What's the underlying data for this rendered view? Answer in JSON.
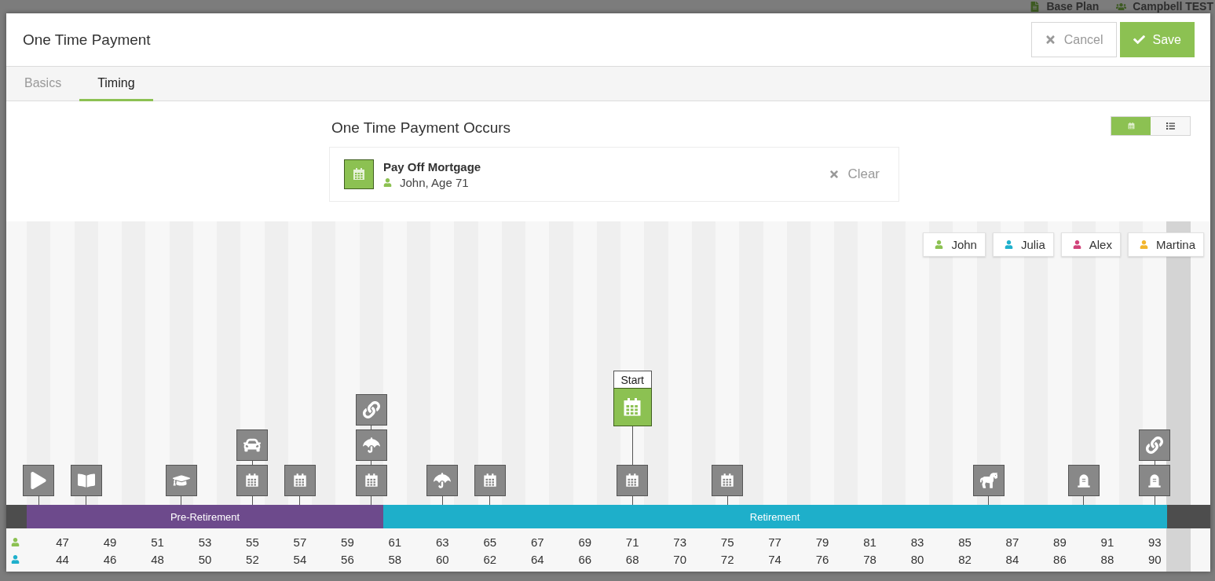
{
  "background_header": {
    "items": [
      {
        "kind": "document",
        "label": "Base Plan"
      },
      {
        "kind": "people",
        "label": "Campbell TEST"
      }
    ]
  },
  "dialog": {
    "title": "One Time Payment",
    "buttons": [
      {
        "kind": "cancel",
        "label": "Cancel"
      },
      {
        "kind": "save",
        "label": "Save"
      }
    ]
  },
  "tabs": [
    {
      "label": "Basics",
      "selected": false
    },
    {
      "label": "Timing",
      "selected": true
    }
  ],
  "occurs": {
    "heading": "One Time Payment Occurs",
    "event": {
      "title": "Pay Off Mortgage",
      "person": "John, Age 71",
      "color": "#8cc152"
    },
    "clear": "Clear"
  },
  "view_toggle": [
    {
      "kind": "calendar",
      "selected": true
    },
    {
      "kind": "list",
      "selected": false
    }
  ],
  "legend": [
    {
      "name": "John",
      "color": "#8cc152"
    },
    {
      "name": "Julia",
      "color": "#1fb0cc"
    },
    {
      "name": "Alex",
      "color": "#d1437a"
    },
    {
      "name": "Martina",
      "color": "#f2b52c"
    }
  ],
  "phases": [
    {
      "kind": "gap",
      "color": "#4d4d4d"
    },
    {
      "kind": "pre",
      "label": "Pre-Retirement",
      "color": "#6d4a8c"
    },
    {
      "kind": "post",
      "label": "Retirement",
      "color": "#1eafca"
    }
  ],
  "age_rows": [
    {
      "color": "#8cc152"
    },
    {
      "color": "#1fb0cc"
    }
  ],
  "slots": [
    {
      "kind": "gap",
      "highlighted": false
    },
    {
      "kind": "pre",
      "highlighted": false,
      "events": [
        {
          "kind": "play"
        }
      ]
    },
    {
      "kind": "pre",
      "highlighted": false,
      "ages": [
        "47",
        "44"
      ]
    },
    {
      "kind": "pre",
      "highlighted": false,
      "events": [
        {
          "kind": "book"
        }
      ]
    },
    {
      "kind": "pre",
      "highlighted": false,
      "ages": [
        "49",
        "46"
      ]
    },
    {
      "kind": "pre",
      "highlighted": false
    },
    {
      "kind": "pre",
      "highlighted": false,
      "ages": [
        "51",
        "48"
      ]
    },
    {
      "kind": "pre",
      "highlighted": false,
      "events": [
        {
          "kind": "graduation"
        }
      ]
    },
    {
      "kind": "pre",
      "highlighted": false,
      "ages": [
        "53",
        "50"
      ]
    },
    {
      "kind": "pre",
      "highlighted": false
    },
    {
      "kind": "pre",
      "highlighted": false,
      "ages": [
        "55",
        "52"
      ],
      "events": [
        {
          "kind": "calendar"
        },
        {
          "kind": "car"
        }
      ]
    },
    {
      "kind": "pre",
      "highlighted": false
    },
    {
      "kind": "pre",
      "highlighted": false,
      "ages": [
        "57",
        "54"
      ],
      "events": [
        {
          "kind": "calendar"
        }
      ]
    },
    {
      "kind": "pre",
      "highlighted": false
    },
    {
      "kind": "pre",
      "highlighted": false,
      "ages": [
        "59",
        "56"
      ]
    },
    {
      "kind": "pre",
      "highlighted": false,
      "events": [
        {
          "kind": "calendar"
        },
        {
          "kind": "umbrella"
        },
        {
          "kind": "link"
        }
      ]
    },
    {
      "kind": "post",
      "highlighted": false,
      "ages": [
        "61",
        "58"
      ]
    },
    {
      "kind": "post",
      "highlighted": false
    },
    {
      "kind": "post",
      "highlighted": false,
      "ages": [
        "63",
        "60"
      ],
      "events": [
        {
          "kind": "umbrella"
        }
      ]
    },
    {
      "kind": "post",
      "highlighted": false
    },
    {
      "kind": "post",
      "highlighted": false,
      "ages": [
        "65",
        "62"
      ],
      "events": [
        {
          "kind": "calendar"
        }
      ]
    },
    {
      "kind": "post",
      "highlighted": false
    },
    {
      "kind": "post",
      "highlighted": false,
      "ages": [
        "67",
        "64"
      ]
    },
    {
      "kind": "post",
      "highlighted": false
    },
    {
      "kind": "post",
      "highlighted": false,
      "ages": [
        "69",
        "66"
      ]
    },
    {
      "kind": "post",
      "highlighted": false
    },
    {
      "kind": "post",
      "highlighted": false,
      "ages": [
        "71",
        "68"
      ],
      "events": [
        {
          "kind": "calendar"
        }
      ],
      "marker": {
        "label": "Start",
        "kind": "calendar"
      }
    },
    {
      "kind": "post",
      "highlighted": false
    },
    {
      "kind": "post",
      "highlighted": false,
      "ages": [
        "73",
        "70"
      ]
    },
    {
      "kind": "post",
      "highlighted": false
    },
    {
      "kind": "post",
      "highlighted": false,
      "ages": [
        "75",
        "72"
      ],
      "events": [
        {
          "kind": "calendar"
        }
      ]
    },
    {
      "kind": "post",
      "highlighted": false
    },
    {
      "kind": "post",
      "highlighted": false,
      "ages": [
        "77",
        "74"
      ]
    },
    {
      "kind": "post",
      "highlighted": false
    },
    {
      "kind": "post",
      "highlighted": false,
      "ages": [
        "79",
        "76"
      ]
    },
    {
      "kind": "post",
      "highlighted": false
    },
    {
      "kind": "post",
      "highlighted": false,
      "ages": [
        "81",
        "78"
      ]
    },
    {
      "kind": "post",
      "highlighted": false
    },
    {
      "kind": "post",
      "highlighted": false,
      "ages": [
        "83",
        "80"
      ]
    },
    {
      "kind": "post",
      "highlighted": false
    },
    {
      "kind": "post",
      "highlighted": false,
      "ages": [
        "85",
        "82"
      ]
    },
    {
      "kind": "post",
      "highlighted": false,
      "events": [
        {
          "kind": "horse"
        }
      ]
    },
    {
      "kind": "post",
      "highlighted": false,
      "ages": [
        "87",
        "84"
      ]
    },
    {
      "kind": "post",
      "highlighted": false
    },
    {
      "kind": "post",
      "highlighted": false,
      "ages": [
        "89",
        "86"
      ]
    },
    {
      "kind": "post",
      "highlighted": false,
      "events": [
        {
          "kind": "tombstone"
        }
      ]
    },
    {
      "kind": "post",
      "highlighted": false,
      "ages": [
        "91",
        "88"
      ]
    },
    {
      "kind": "post",
      "highlighted": false
    },
    {
      "kind": "post",
      "highlighted": false,
      "ages": [
        "93",
        "90"
      ],
      "events": [
        {
          "kind": "tombstone"
        },
        {
          "kind": "link"
        }
      ]
    },
    {
      "kind": "gap",
      "highlighted": true
    },
    {
      "kind": "gap",
      "highlighted": false
    }
  ]
}
